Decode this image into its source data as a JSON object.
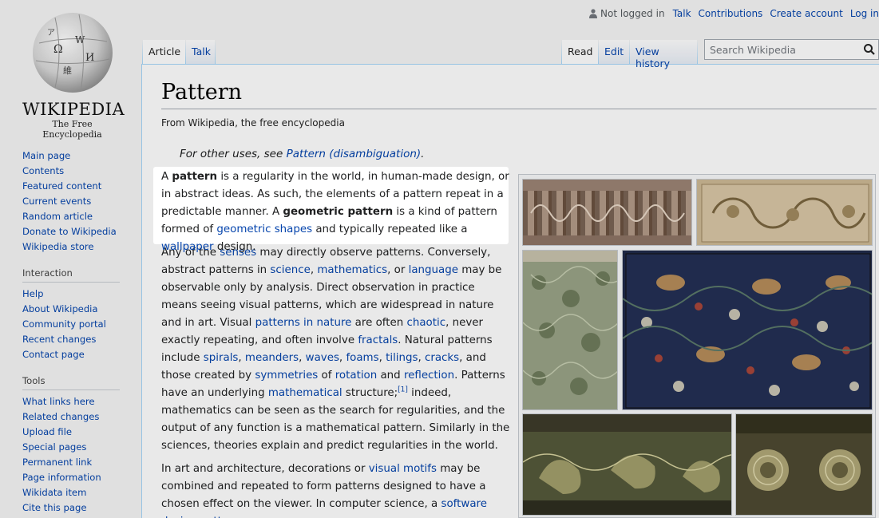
{
  "logo": {
    "wordmark": "WIKIPEDIA",
    "tagline": "The Free Encyclopedia"
  },
  "sidebar": {
    "main": [
      "Main page",
      "Contents",
      "Featured content",
      "Current events",
      "Random article",
      "Donate to Wikipedia",
      "Wikipedia store"
    ],
    "interaction_heading": "Interaction",
    "interaction": [
      "Help",
      "About Wikipedia",
      "Community portal",
      "Recent changes",
      "Contact page"
    ],
    "tools_heading": "Tools",
    "tools": [
      "What links here",
      "Related changes",
      "Upload file",
      "Special pages",
      "Permanent link",
      "Page information",
      "Wikidata item",
      "Cite this page"
    ]
  },
  "personal": {
    "status": "Not logged in",
    "links": [
      "Talk",
      "Contributions",
      "Create account",
      "Log in"
    ]
  },
  "tabs": {
    "article": "Article",
    "talk": "Talk",
    "read": "Read",
    "edit": "Edit",
    "history": "View history"
  },
  "search": {
    "placeholder": "Search Wikipedia"
  },
  "page": {
    "title": "Pattern",
    "sitesub": "From Wikipedia, the free encyclopedia",
    "hatnote_prefix": "For other uses, see ",
    "hatnote_link": "Pattern (disambiguation)",
    "hatnote_suffix": "."
  },
  "paragraphs": {
    "p1": {
      "t1": "A ",
      "b1": "pattern",
      "t2": " is a regularity in the world, in human-made design, or in abstract ideas. As such, the elements of a pattern repeat in a predictable manner. A ",
      "b2": "geometric pattern",
      "t3": " is a kind of pattern formed of ",
      "l1": "geometric shapes",
      "t4": " and typically repeated like a ",
      "l2": "wallpaper",
      "t5": " design."
    },
    "p2": {
      "t1": "Any of the ",
      "l1": "senses",
      "t2": " may directly observe patterns. Conversely, abstract patterns in ",
      "l2": "science",
      "t3": ", ",
      "l3": "mathematics",
      "t4": ", or ",
      "l4": "language",
      "t5": " may be observable only by analysis. Direct observation in practice means seeing visual patterns, which are widespread in nature and in art. Visual ",
      "l5": "patterns in nature",
      "t6": " are often ",
      "l6": "chaotic",
      "t7": ", never exactly repeating, and often involve ",
      "l7": "fractals",
      "t8": ". Natural patterns include ",
      "l8": "spirals",
      "t9": ", ",
      "l9": "meanders",
      "t10": ", ",
      "l10": "waves",
      "t11": ", ",
      "l11": "foams",
      "t12": ", ",
      "l12": "tilings",
      "t13": ", ",
      "l13": "cracks",
      "t14": ", and those created by ",
      "l14": "symmetries",
      "t15": " of ",
      "l15": "rotation",
      "t16": " and ",
      "l16": "reflection",
      "t17": ". Patterns have an underlying ",
      "l17": "mathematical",
      "t18": " structure;",
      "ref": "[1]",
      "t19": " indeed, mathematics can be seen as the search for regularities, and the output of any function is a mathematical pattern. Similarly in the sciences, theories explain and predict regularities in the world."
    },
    "p3": {
      "t1": "In art and architecture, decorations or ",
      "l1": "visual motifs",
      "t2": " may be combined and repeated to form patterns designed to have a chosen effect on the viewer. In computer science, a ",
      "l2": "software design pattern"
    }
  },
  "colors": {
    "link": "#0645ad",
    "border": "#a7d7f9",
    "text": "#202122"
  }
}
